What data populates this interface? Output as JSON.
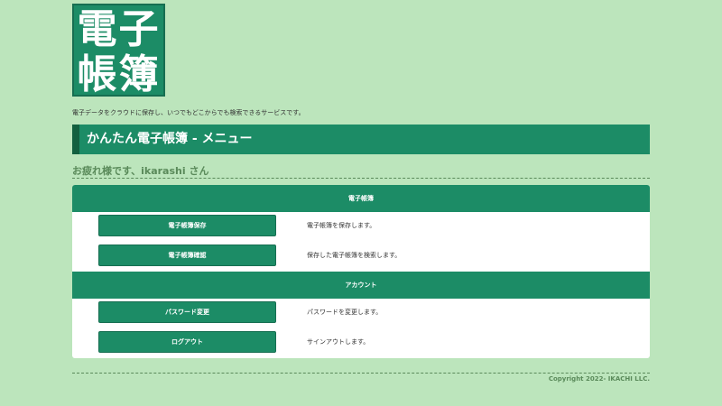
{
  "logo": {
    "line1": "電子",
    "line2": "帳簿"
  },
  "tagline": "電子データをクラウドに保存し、いつでもどこからでも検索できるサービスです。",
  "page_title": "かんたん電子帳簿 - メニュー",
  "greeting": "お疲れ様です、ikarashi さん",
  "sections": [
    {
      "heading": "電子帳簿",
      "items": [
        {
          "label": "電子帳簿保存",
          "description": "電子帳簿を保存します。"
        },
        {
          "label": "電子帳簿確認",
          "description": "保存した電子帳簿を検索します。"
        }
      ]
    },
    {
      "heading": "アカウント",
      "items": [
        {
          "label": "パスワード変更",
          "description": "パスワードを変更します。"
        },
        {
          "label": "ログアウト",
          "description": "サインアウトします。"
        }
      ]
    }
  ],
  "footer": {
    "copyright": "Copyright 2022- IKACHI LLC."
  },
  "colors": {
    "background": "#bce5bc",
    "primary": "#1c8c66",
    "primary_dark": "#12603f",
    "muted_text": "#5a8a5a"
  }
}
